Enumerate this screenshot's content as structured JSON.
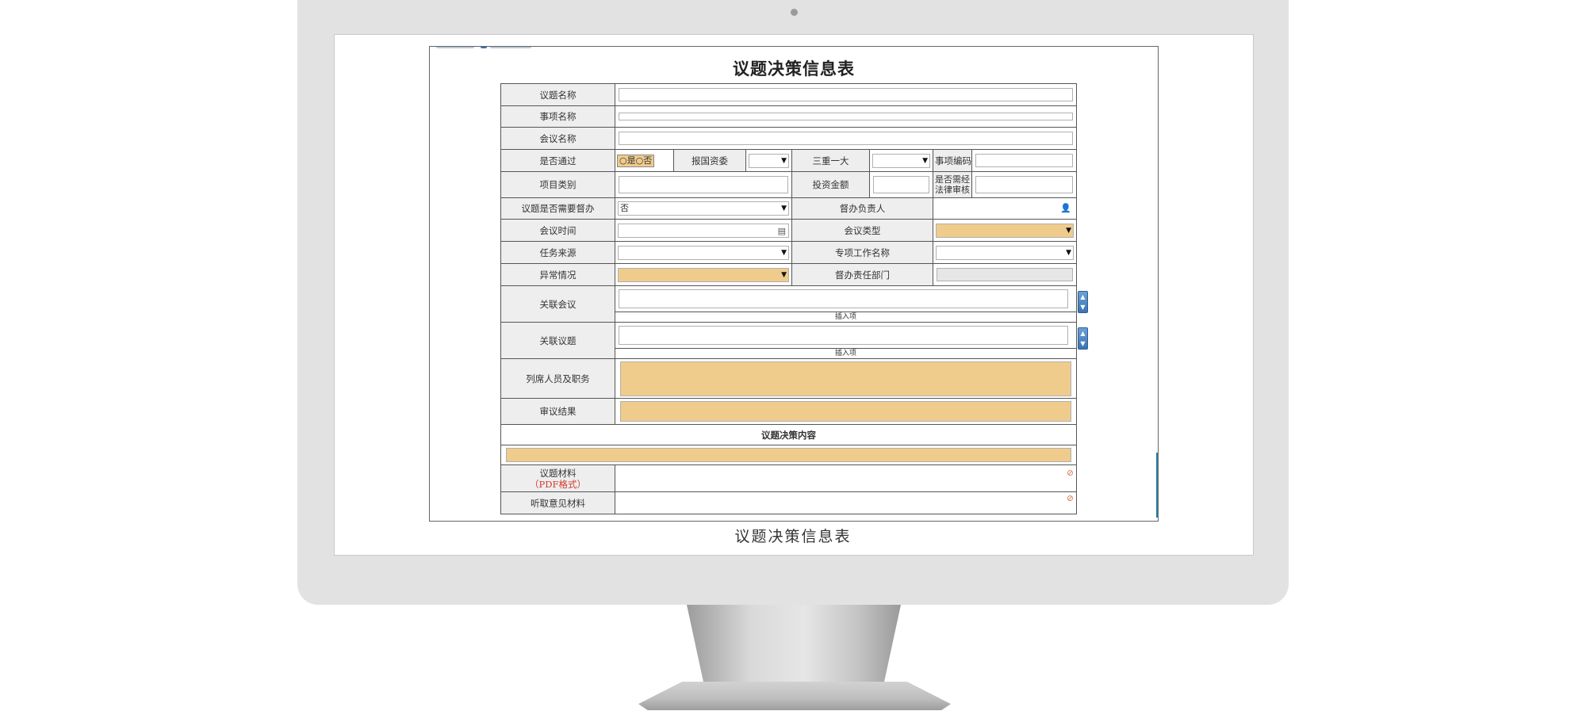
{
  "form": {
    "title": "议题决策信息表",
    "caption": "议题决策信息表",
    "labels": {
      "topic_name": "议题名称",
      "item_name": "事项名称",
      "meeting_name": "会议名称",
      "passed": "是否通过",
      "report_sasac": "报国资委",
      "three_one": "三重一大",
      "item_code": "事项编码",
      "project_type": "项目类别",
      "investment": "投资金额",
      "legal_review": "是否需经法律审核",
      "need_supervise": "议题是否需要督办",
      "supervisor": "督办负责人",
      "meeting_time": "会议时间",
      "meeting_type": "会议类型",
      "task_source": "任务来源",
      "special_work": "专项工作名称",
      "abnormal": "异常情况",
      "supervise_dept": "督办责任部门",
      "related_meeting": "关联会议",
      "related_topic": "关联议题",
      "attendees": "列席人员及职务",
      "review_result": "审议结果",
      "decision_content": "议题决策内容",
      "topic_material": "议题材料",
      "pdf_format": "（PDF格式）",
      "opinion_material": "听取意见材料"
    },
    "radio_yes": "是",
    "radio_no": "否",
    "need_supervise_value": "否",
    "insert_item": "插入项",
    "accent_orange": "#f0cc8c",
    "blue_button": "#3a74b6"
  }
}
